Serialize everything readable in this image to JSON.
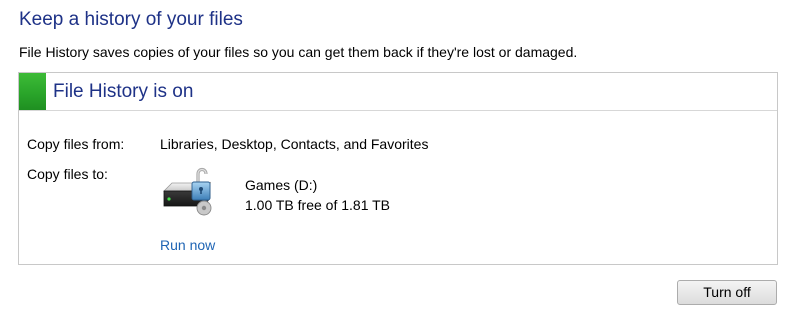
{
  "page": {
    "title": "Keep a history of your files",
    "description": "File History saves copies of your files so you can get them back if they're lost or damaged."
  },
  "status": {
    "text": "File History is on",
    "color": "#2aa52a"
  },
  "copy_from": {
    "label": "Copy files from:",
    "value": "Libraries, Desktop, Contacts, and Favorites"
  },
  "copy_to": {
    "label": "Copy files to:",
    "drive_name": "Games (D:)",
    "drive_space": "1.00 TB free of 1.81 TB",
    "icon": "drive-lock-icon"
  },
  "actions": {
    "run_now": "Run now",
    "turn_off": "Turn off"
  },
  "colors": {
    "heading": "#1e3287",
    "link": "#1e64b4",
    "status_green": "#2aa52a"
  }
}
